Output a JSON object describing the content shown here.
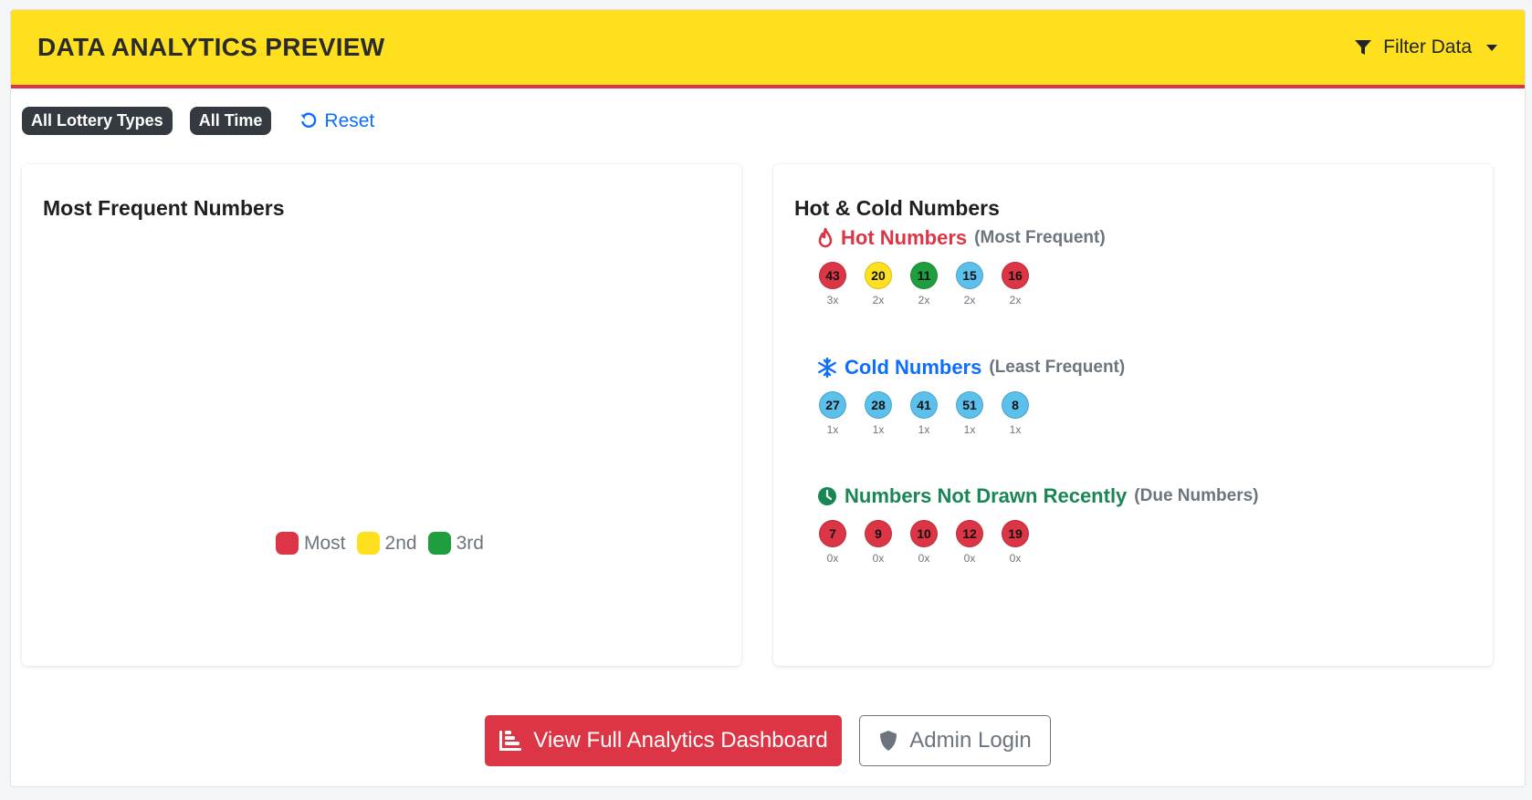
{
  "header": {
    "title": "DATA ANALYTICS PREVIEW",
    "filter_label": "Filter Data"
  },
  "filters": {
    "chips": [
      "All Lottery Types",
      "All Time"
    ],
    "reset_label": "Reset"
  },
  "frequent_panel": {
    "title": "Most Frequent Numbers",
    "legend": [
      {
        "label": "Most",
        "color": "#dc3545"
      },
      {
        "label": "2nd",
        "color": "#ffe01f"
      },
      {
        "label": "3rd",
        "color": "#1e9e3e"
      }
    ]
  },
  "hot_cold_panel": {
    "title": "Hot & Cold Numbers",
    "hot": {
      "title": "Hot Numbers",
      "subtitle": "(Most Frequent)",
      "color": "#dc3545",
      "icon": "fire-icon",
      "numbers": [
        {
          "n": "43",
          "count": "3x",
          "color": "#dc3545"
        },
        {
          "n": "20",
          "count": "2x",
          "color": "#ffe01f"
        },
        {
          "n": "11",
          "count": "2x",
          "color": "#1e9e3e"
        },
        {
          "n": "15",
          "count": "2x",
          "color": "#5bc0eb"
        },
        {
          "n": "16",
          "count": "2x",
          "color": "#dc3545"
        }
      ]
    },
    "cold": {
      "title": "Cold Numbers",
      "subtitle": "(Least Frequent)",
      "color": "#0d6efd",
      "icon": "snowflake-icon",
      "numbers": [
        {
          "n": "27",
          "count": "1x",
          "color": "#5bc0eb"
        },
        {
          "n": "28",
          "count": "1x",
          "color": "#5bc0eb"
        },
        {
          "n": "41",
          "count": "1x",
          "color": "#5bc0eb"
        },
        {
          "n": "51",
          "count": "1x",
          "color": "#5bc0eb"
        },
        {
          "n": "8",
          "count": "1x",
          "color": "#5bc0eb"
        }
      ]
    },
    "due": {
      "title": "Numbers Not Drawn Recently",
      "subtitle": "(Due Numbers)",
      "color": "#198754",
      "icon": "clock-icon",
      "numbers": [
        {
          "n": "7",
          "count": "0x",
          "color": "#dc3545"
        },
        {
          "n": "9",
          "count": "0x",
          "color": "#dc3545"
        },
        {
          "n": "10",
          "count": "0x",
          "color": "#dc3545"
        },
        {
          "n": "12",
          "count": "0x",
          "color": "#dc3545"
        },
        {
          "n": "19",
          "count": "0x",
          "color": "#dc3545"
        }
      ]
    }
  },
  "actions": {
    "dashboard_label": "View Full Analytics Dashboard",
    "admin_label": "Admin Login"
  }
}
